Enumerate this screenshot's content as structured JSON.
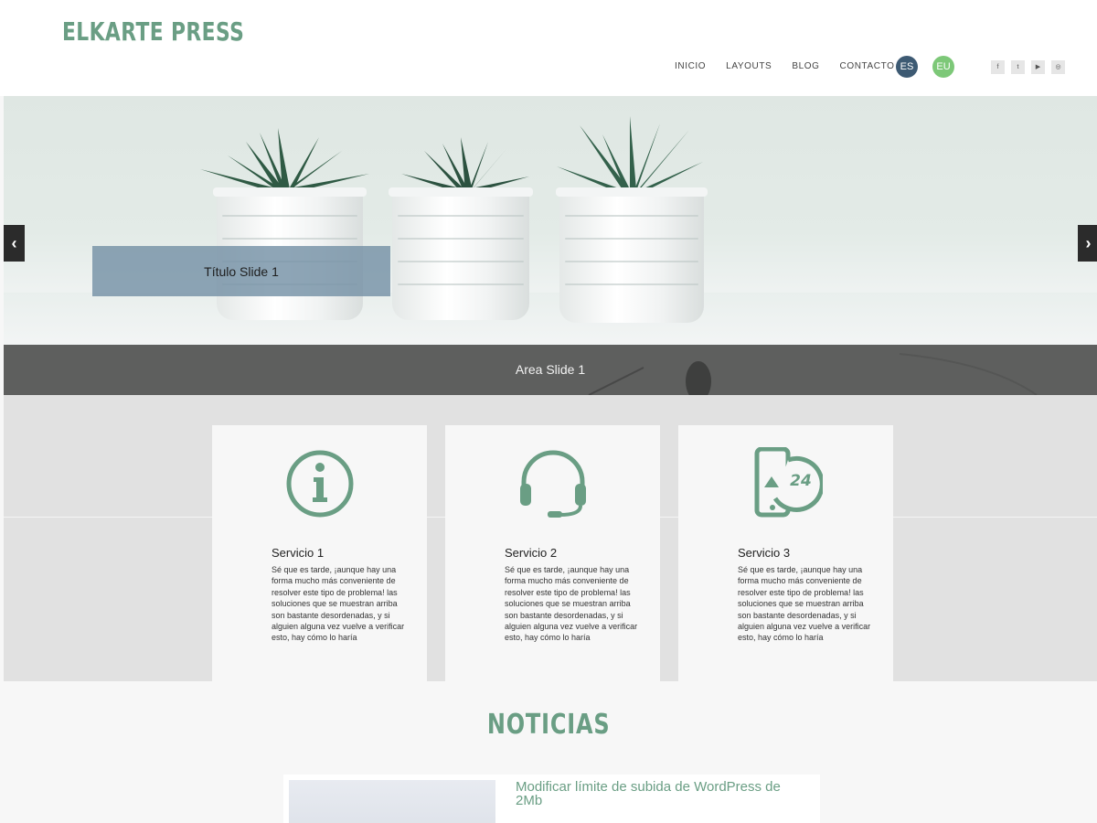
{
  "site": {
    "logo": "ELKARTE PRESS",
    "accent_color": "#6a9e84"
  },
  "nav": {
    "items": [
      "INICIO",
      "LAYOUTS",
      "BLOG",
      "CONTACTO"
    ]
  },
  "languages": [
    {
      "code": "ES",
      "color": "#3d5a73"
    },
    {
      "code": "EU",
      "color": "#7dc878"
    }
  ],
  "social": [
    {
      "icon": "facebook-icon",
      "glyph": "f"
    },
    {
      "icon": "tumblr-icon",
      "glyph": "t"
    },
    {
      "icon": "youtube-icon",
      "glyph": "▶"
    },
    {
      "icon": "instagram-icon",
      "glyph": "◎"
    }
  ],
  "hero": {
    "slide_title": "Título Slide 1",
    "area_label": "Area Slide 1",
    "prev_icon": "chevron-left-icon",
    "next_icon": "chevron-right-icon",
    "prev_glyph": "‹",
    "next_glyph": "›"
  },
  "services": [
    {
      "icon": "info-circle-icon",
      "title": "Servicio 1",
      "text": "Sé que es tarde, ¡aunque hay una forma mucho más conveniente de resolver este tipo de problema! las soluciones que se muestran arriba son bastante desordenadas, y si alguien alguna vez vuelve a verificar esto, hay cómo lo haría"
    },
    {
      "icon": "headset-icon",
      "title": "Servicio 2",
      "text": "Sé que es tarde, ¡aunque hay una forma mucho más conveniente de resolver este tipo de problema! las soluciones que se muestran arriba son bastante desordenadas, y si alguien alguna vez vuelve a verificar esto, hay cómo lo haría"
    },
    {
      "icon": "phone-24h-icon",
      "icon_text": "24",
      "title": "Servicio 3",
      "text": "Sé que es tarde, ¡aunque hay una forma mucho más conveniente de resolver este tipo de problema! las soluciones que se muestran arriba son bastante desordenadas, y si alguien alguna vez vuelve a verificar esto, hay cómo lo haría"
    }
  ],
  "news": {
    "title": "NOTICIAS",
    "items": [
      {
        "title": "Modificar límite de subida de WordPress de 2Mb"
      }
    ]
  }
}
